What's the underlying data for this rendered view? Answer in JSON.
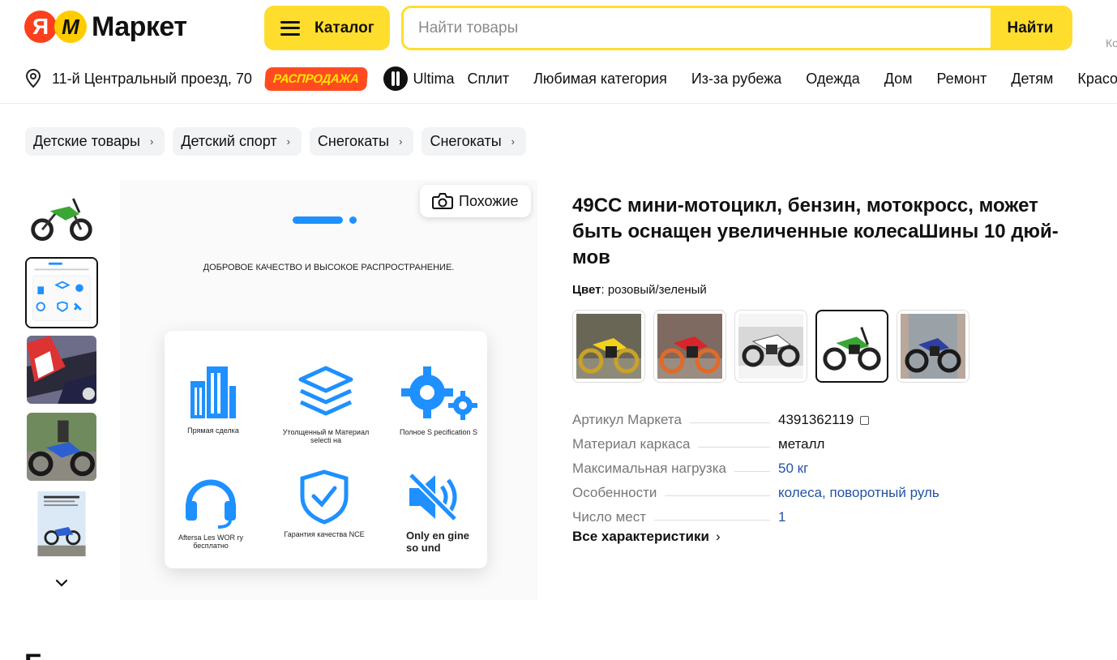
{
  "header": {
    "logo_ya": "Я",
    "logo_m": "М",
    "logo_text": "Маркет",
    "catalog_label": "Каталог",
    "search_placeholder": "Найти товары",
    "search_button": "Найти",
    "edge_text": "Ко"
  },
  "subnav": {
    "address": "11-й Центральный проезд, 70",
    "sale_badge": "РАСПРОДАЖА",
    "ultima": "Ultima",
    "links": [
      "Сплит",
      "Любимая категория",
      "Из-за рубежа",
      "Одежда",
      "Дом",
      "Ремонт",
      "Детям",
      "Красота"
    ]
  },
  "breadcrumb": [
    "Детские товары",
    "Детский спорт",
    "Снегокаты",
    "Снегокаты"
  ],
  "gallery": {
    "similar_label": "Похожие",
    "image_heading": "ДОБРОВОЕ КАЧЕСТВО И ВЫСОКОЕ РАСПРОСТРАНЕНИЕ.",
    "features": [
      {
        "label": "Прямая сделка",
        "icon": "building-icon"
      },
      {
        "label": "Утолщенный м Материал selecti на",
        "icon": "layers-icon"
      },
      {
        "label": "Полное S pecification S",
        "icon": "gears-icon"
      },
      {
        "label": "Aftersa Les WOR ry бесплатно",
        "icon": "headphones-icon"
      },
      {
        "label": "Гарантия качества NCE",
        "icon": "shield-check-icon"
      },
      {
        "label": "Only en gine so und",
        "icon": "speaker-mute-icon"
      }
    ]
  },
  "product": {
    "title": "49СС мини-мотоцикл, бензин, мотокросс, может быть оснащен увеличенные колесаШины 10 дюй-мов",
    "color_label": "Цвет",
    "color_value": ": розовый/зеленый",
    "specs": [
      {
        "key": "Артикул Маркета",
        "value": "4391362119"
      },
      {
        "key": "Материал каркаса",
        "value": "металл"
      },
      {
        "key": "Максимальная нагрузка",
        "value": "50 кг"
      },
      {
        "key": "Особенности",
        "value": "колеса, поворотный руль"
      },
      {
        "key": "Число мест",
        "value": "1"
      }
    ],
    "all_specs": "Все характеристики"
  },
  "colors": {
    "accent": "#ffdd2d",
    "sale": "#ff4b1f",
    "link": "#2352a3",
    "icon_blue": "#1e90ff"
  },
  "footer_partial": "Б"
}
